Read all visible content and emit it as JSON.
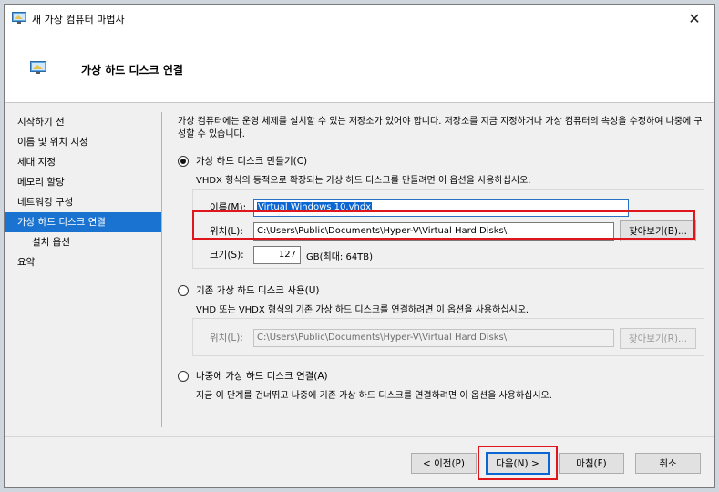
{
  "window": {
    "title": "새 가상 컴퓨터 마법사"
  },
  "header": {
    "title": "가상 하드 디스크 연결"
  },
  "nav": {
    "items": [
      {
        "label": "시작하기 전"
      },
      {
        "label": "이름 및 위치 지정"
      },
      {
        "label": "세대 지정"
      },
      {
        "label": "메모리 할당"
      },
      {
        "label": "네트워킹 구성"
      },
      {
        "label": "가상 하드 디스크 연결",
        "active": true
      },
      {
        "label": "설치 옵션",
        "sub": true
      },
      {
        "label": "요약"
      }
    ]
  },
  "intro": "가상 컴퓨터에는 운영 체제를 설치할 수 있는 저장소가 있어야 합니다. 저장소를 지금 지정하거나 가상 컴퓨터의 속성을 수정하여 나중에 구성할 수 있습니다.",
  "option_create": {
    "label": "가상 하드 디스크 만들기(C)",
    "description": "VHDX 형식의 동적으로 확장되는 가상 하드 디스크를 만들려면 이 옵션을 사용하십시오.",
    "name_label": "이름(M):",
    "name_value": "Virtual Windows 10.vhdx",
    "location_label": "위치(L):",
    "location_value": "C:\\Users\\Public\\Documents\\Hyper-V\\Virtual Hard Disks\\",
    "browse_label": "찾아보기(B)...",
    "size_label": "크기(S):",
    "size_value": "127",
    "size_unit": "GB(최대: 64TB)"
  },
  "option_existing": {
    "label": "기존 가상 하드 디스크 사용(U)",
    "description": "VHD 또는 VHDX 형식의 기존 가상 하드 디스크를 연결하려면 이 옵션을 사용하십시오.",
    "location_label": "위치(L):",
    "location_value": "C:\\Users\\Public\\Documents\\Hyper-V\\Virtual Hard Disks\\",
    "browse_label": "찾아보기(R)..."
  },
  "option_later": {
    "label": "나중에 가상 하드 디스크 연결(A)",
    "description": "지금 이 단계를 건너뛰고 나중에 기존 가상 하드 디스크를 연결하려면 이 옵션을 사용하십시오."
  },
  "buttons": {
    "prev": "< 이전(P)",
    "next": "다음(N) >",
    "finish": "마침(F)",
    "cancel": "취소"
  },
  "icons": {
    "title": "wizard-monitor-icon",
    "header": "wizard-monitor-icon",
    "close": "close-icon"
  },
  "colors": {
    "accent": "#1a73d1",
    "highlight_box": "#e0161d"
  }
}
